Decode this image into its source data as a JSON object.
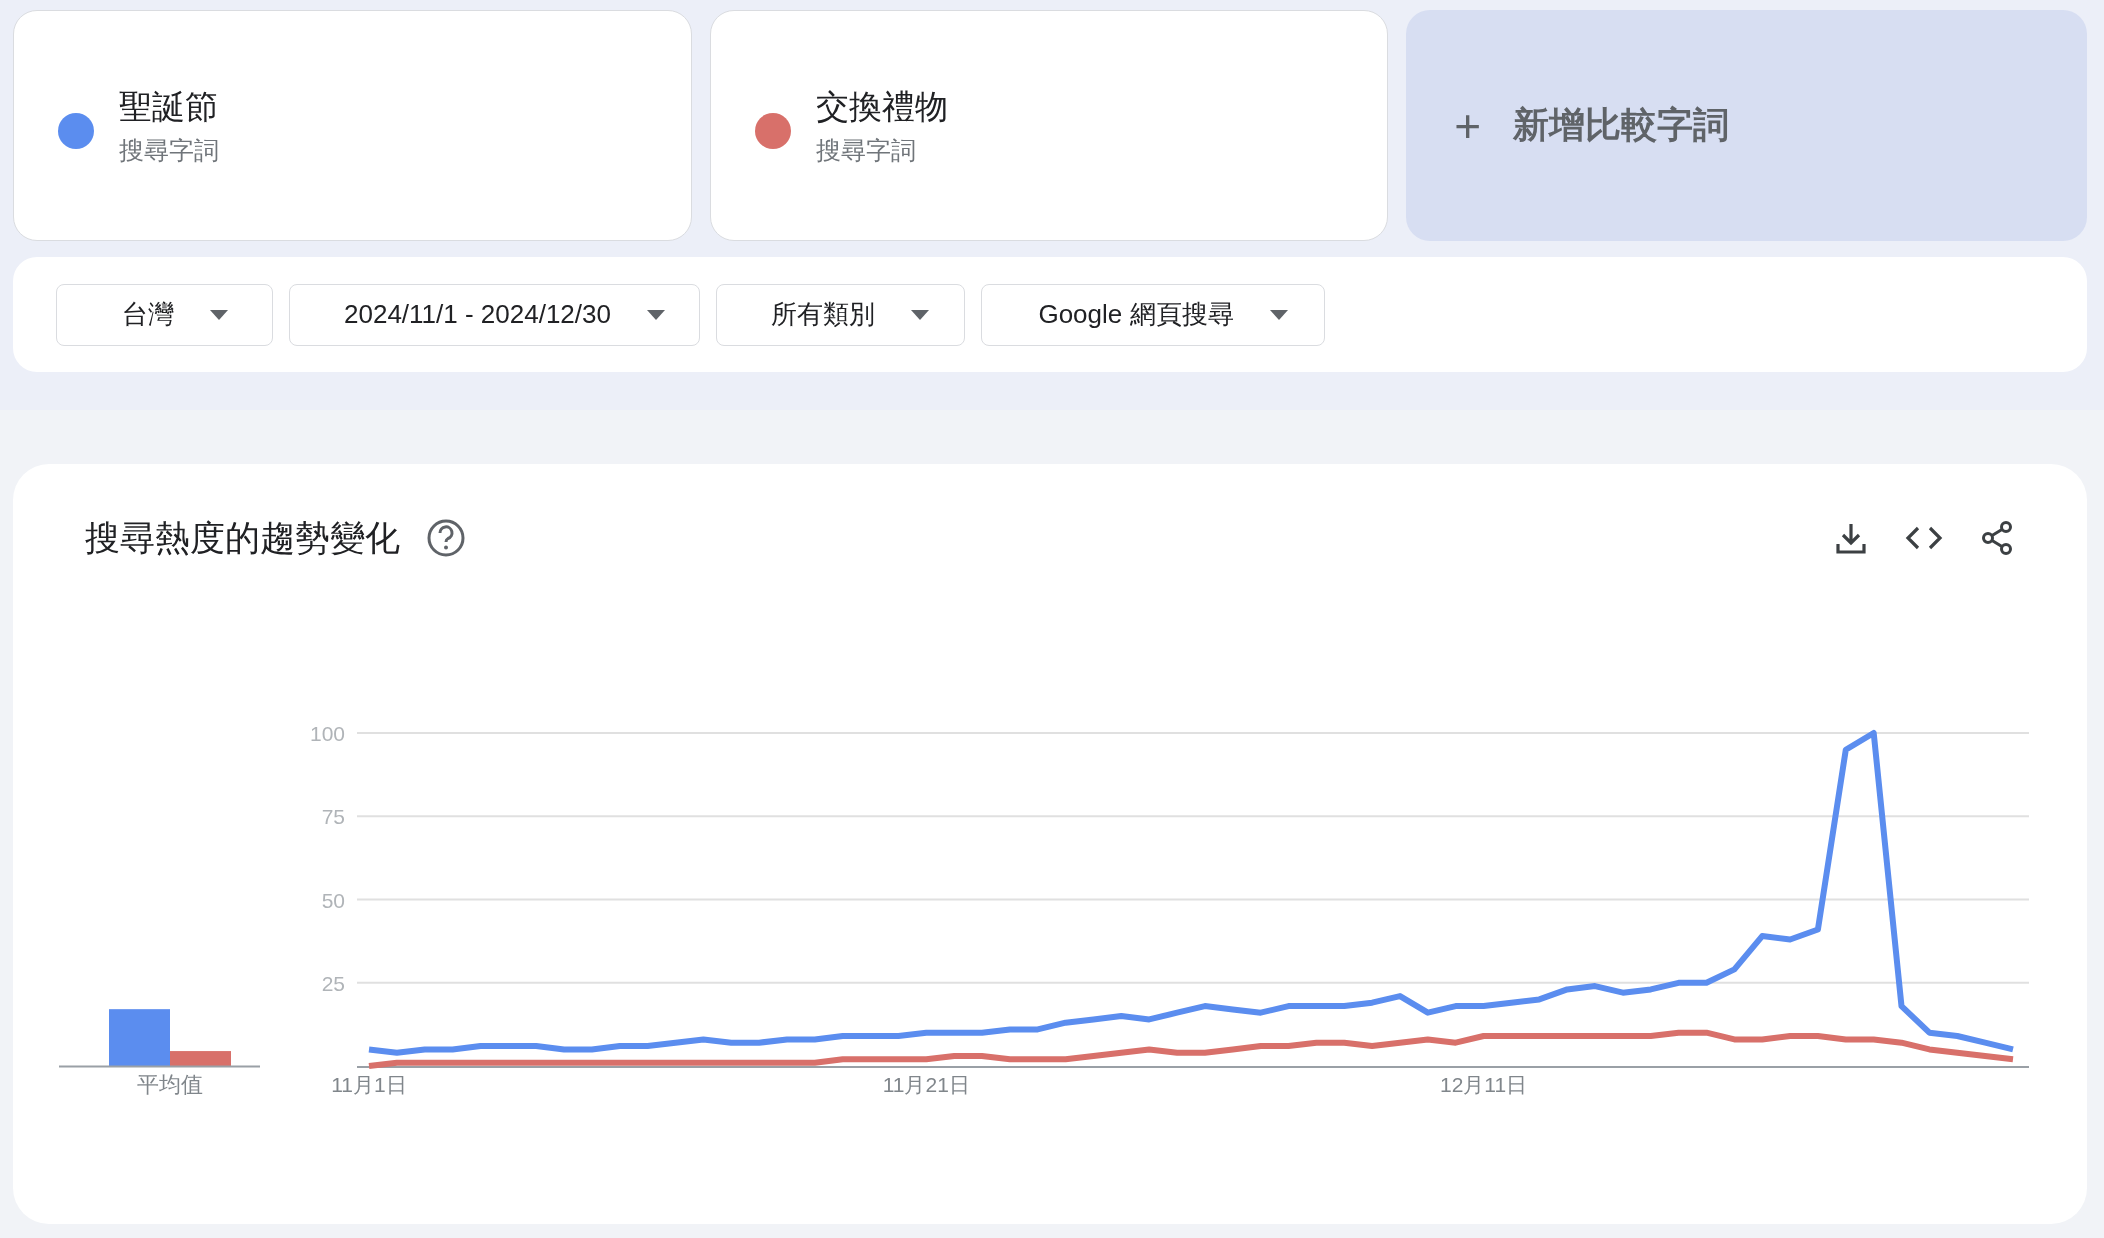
{
  "terms": [
    {
      "name": "聖誕節",
      "subtitle": "搜尋字詞",
      "color": "#5b8def"
    },
    {
      "name": "交換禮物",
      "subtitle": "搜尋字詞",
      "color": "#d8706a"
    }
  ],
  "add_term": {
    "icon": "+",
    "label": "新增比較字詞"
  },
  "filters": [
    {
      "label": "台灣"
    },
    {
      "label": "2024/11/1 - 2024/12/30"
    },
    {
      "label": "所有類別"
    },
    {
      "label": "Google 網頁搜尋"
    }
  ],
  "trend_card": {
    "title": "搜尋熱度的趨勢變化",
    "average_label": "平均值",
    "chart_data": {
      "type": "line",
      "categories": [
        "11月1日",
        null,
        null,
        null,
        null,
        null,
        null,
        null,
        null,
        null,
        null,
        null,
        null,
        null,
        null,
        null,
        null,
        null,
        null,
        null,
        "11月21日",
        null,
        null,
        null,
        null,
        null,
        null,
        null,
        null,
        null,
        null,
        null,
        null,
        null,
        null,
        null,
        null,
        null,
        null,
        null,
        "12月11日",
        null,
        null,
        null,
        null,
        null,
        null,
        null,
        null,
        null,
        null,
        null,
        null,
        null,
        null,
        null,
        null,
        null,
        null,
        null
      ],
      "yticks": [
        25,
        50,
        75,
        100
      ],
      "ylim": [
        0,
        100
      ],
      "grid": true,
      "series": [
        {
          "color": "#5b8def",
          "values": [
            5,
            4,
            5,
            5,
            6,
            6,
            6,
            5,
            5,
            6,
            6,
            7,
            8,
            7,
            7,
            8,
            8,
            9,
            9,
            9,
            10,
            10,
            10,
            11,
            11,
            13,
            14,
            15,
            14,
            16,
            18,
            17,
            16,
            18,
            18,
            18,
            19,
            21,
            16,
            18,
            18,
            19,
            20,
            23,
            24,
            22,
            23,
            25,
            25,
            29,
            39,
            38,
            41,
            95,
            100,
            18,
            10,
            9,
            7,
            5
          ]
        },
        {
          "color": "#d8706a",
          "values": [
            0,
            1,
            1,
            1,
            1,
            1,
            1,
            1,
            1,
            1,
            1,
            1,
            1,
            1,
            1,
            1,
            1,
            2,
            2,
            2,
            2,
            3,
            3,
            2,
            2,
            2,
            3,
            4,
            5,
            4,
            4,
            5,
            6,
            6,
            7,
            7,
            6,
            7,
            8,
            7,
            9,
            9,
            9,
            9,
            9,
            9,
            9,
            10,
            10,
            8,
            8,
            9,
            9,
            8,
            8,
            7,
            5,
            4,
            3,
            2
          ]
        }
      ]
    }
  }
}
